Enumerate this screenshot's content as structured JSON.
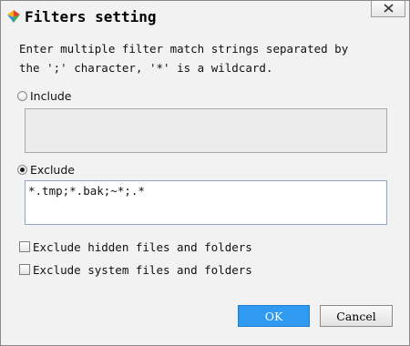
{
  "window": {
    "title": "Filters setting"
  },
  "description": {
    "line1": "Enter multiple filter match strings separated by",
    "line2": "the ';' character, '*' is a wildcard."
  },
  "include": {
    "label": "Include",
    "selected": false,
    "value": ""
  },
  "exclude": {
    "label": "Exclude",
    "selected": true,
    "value": "*.tmp;*.bak;~*;.*"
  },
  "options": {
    "hidden_label": "Exclude hidden files and folders",
    "hidden_checked": false,
    "system_label": "Exclude system files and folders",
    "system_checked": false
  },
  "buttons": {
    "ok_label": "OK",
    "cancel_label": "Cancel"
  },
  "colors": {
    "ok_button": "#2f9af0",
    "dialog_background": "#f2f2f2"
  },
  "icons": {
    "app": "app-logo-icon",
    "close": "close-icon"
  }
}
